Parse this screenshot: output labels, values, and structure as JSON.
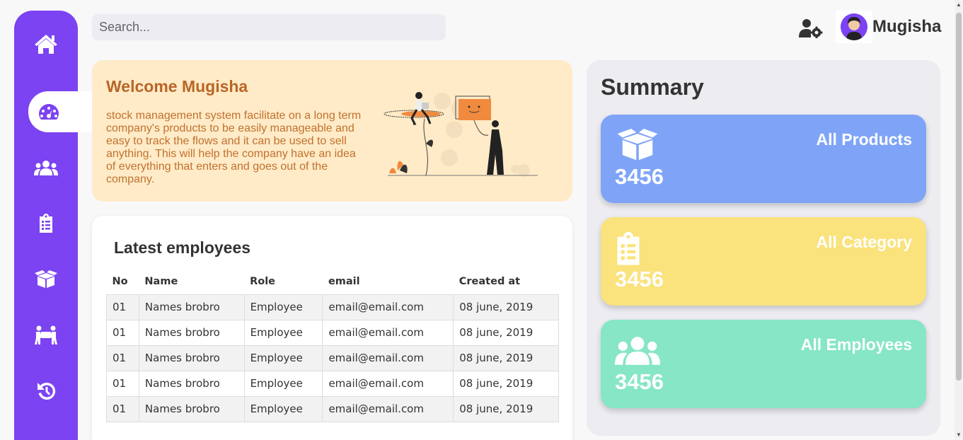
{
  "search": {
    "placeholder": "Search..."
  },
  "user": {
    "name": "Mugisha"
  },
  "sidebar": {
    "items": [
      {
        "icon": "home-icon"
      },
      {
        "icon": "dashboard-icon",
        "active": true
      },
      {
        "icon": "users-icon"
      },
      {
        "icon": "clipboard-list-icon"
      },
      {
        "icon": "box-open-icon"
      },
      {
        "icon": "people-carry-icon"
      },
      {
        "icon": "history-icon"
      }
    ]
  },
  "welcome": {
    "title": "Welcome Mugisha",
    "text": "stock management system facilitate on a long term company's products to be easily manageable and easy to track the flows and it can be used to sell anything. This will help the company have an idea of everything that enters and goes out of the company."
  },
  "employees": {
    "title": "Latest employees",
    "columns": [
      "No",
      "Name",
      "Role",
      "email",
      "Created at"
    ],
    "rows": [
      [
        "01",
        "Names brobro",
        "Employee",
        "email@email.com",
        "08 june, 2019"
      ],
      [
        "01",
        "Names brobro",
        "Employee",
        "email@email.com",
        "08 june, 2019"
      ],
      [
        "01",
        "Names brobro",
        "Employee",
        "email@email.com",
        "08 june, 2019"
      ],
      [
        "01",
        "Names brobro",
        "Employee",
        "email@email.com",
        "08 june, 2019"
      ],
      [
        "01",
        "Names brobro",
        "Employee",
        "email@email.com",
        "08 june, 2019"
      ]
    ]
  },
  "summary": {
    "title": "Summary",
    "cards": [
      {
        "title": "All Products",
        "value": "3456",
        "color": "#7fa4f7",
        "icon": "box-open-icon"
      },
      {
        "title": "All Category",
        "value": "3456",
        "color": "#fae27d",
        "icon": "clipboard-list-icon"
      },
      {
        "title": "All Employees",
        "value": "3456",
        "color": "#86e6c6",
        "icon": "users-icon"
      }
    ]
  },
  "colors": {
    "sidebar": "#7b43f1",
    "welcome_bg": "#ffebc7",
    "welcome_text": "#b96526"
  }
}
